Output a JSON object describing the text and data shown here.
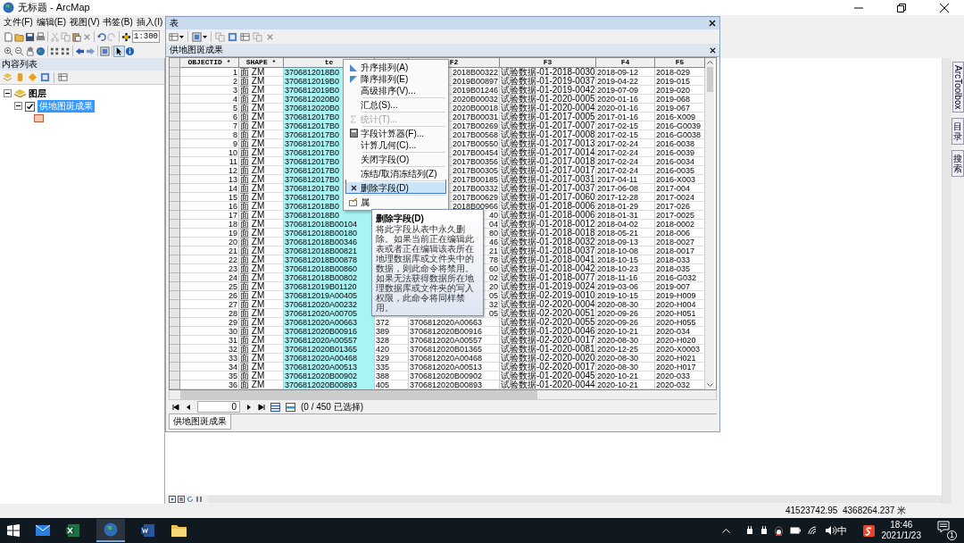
{
  "window": {
    "title": "无标题 - ArcMap"
  },
  "menu_bar": [
    "文件(F)",
    "编辑(E)",
    "视图(V)",
    "书签(B)",
    "插入(I)"
  ],
  "scale_field": {
    "value": "1:300"
  },
  "toc": {
    "title": "内容列表",
    "tree": [
      {
        "label": "图层",
        "expanded": true,
        "children": [
          {
            "label": "供地图斑成果",
            "expanded": true,
            "checked": true,
            "selected": true
          }
        ]
      }
    ]
  },
  "table_window": {
    "title": "表",
    "tab_title": "供地图斑成果",
    "columns": [
      {
        "label": "OBJECTID *",
        "selected": false
      },
      {
        "label": "SHAPE *",
        "selected": false
      },
      {
        "label": "te",
        "selected": true
      },
      {
        "selected": false
      },
      {
        "label": "F2",
        "selected": false
      },
      {
        "label": "F3",
        "selected": false
      },
      {
        "label": "F4",
        "selected": false
      },
      {
        "label": "F5",
        "selected": false
      }
    ],
    "rows": [
      {
        "objectid": "1",
        "shape": "面 ZM",
        "text": "3706812018B0",
        "f2": "2018B00322",
        "f3": "试验数据-01-2018-0030",
        "f4": "2018-09-12",
        "f5": "2018-029"
      },
      {
        "objectid": "2",
        "shape": "面 ZM",
        "text": "3706812019B0",
        "f2": "2019B00897",
        "f3": "试验数据-01-2019-0037",
        "f4": "2019-04-22",
        "f5": "2019-015"
      },
      {
        "objectid": "3",
        "shape": "面 ZM",
        "text": "3706812019B0",
        "f2": "2019B01246",
        "f3": "试验数据-01-2019-0042",
        "f4": "2019-07-09",
        "f5": "2019-020"
      },
      {
        "objectid": "4",
        "shape": "面 ZM",
        "text": "3706812020B0",
        "f2": "2020B00032",
        "f3": "试验数据-01-2020-0005",
        "f4": "2020-01-16",
        "f5": "2019-068"
      },
      {
        "objectid": "5",
        "shape": "面 ZM",
        "text": "3706812020B0",
        "f2": "2020B00018",
        "f3": "试验数据-01-2020-0004",
        "f4": "2020-01-16",
        "f5": "2019-067"
      },
      {
        "objectid": "6",
        "shape": "面 ZM",
        "text": "3706812017B0",
        "f2": "2017B00031",
        "f3": "试验数据-01-2017-0005",
        "f4": "2017-01-16",
        "f5": "2016-X009"
      },
      {
        "objectid": "7",
        "shape": "面 ZM",
        "text": "3706812017B0",
        "f2": "2017B00269",
        "f3": "试验数据-01-2017-0007",
        "f4": "2017-02-15",
        "f5": "2016-G0039"
      },
      {
        "objectid": "8",
        "shape": "面 ZM",
        "text": "3706812017B0",
        "f2": "2017B00568",
        "f3": "试验数据-01-2017-0008",
        "f4": "2017-02-15",
        "f5": "2016-G0038"
      },
      {
        "objectid": "9",
        "shape": "面 ZM",
        "text": "3706812017B0",
        "f2": "2017B00550",
        "f3": "试验数据-01-2017-0013",
        "f4": "2017-02-24",
        "f5": "2016-0038"
      },
      {
        "objectid": "10",
        "shape": "面 ZM",
        "text": "3706812017B0",
        "f2": "2017B00454",
        "f3": "试验数据-01-2017-0014",
        "f4": "2017-02-24",
        "f5": "2016-0039"
      },
      {
        "objectid": "11",
        "shape": "面 ZM",
        "text": "3706812017B0",
        "f2": "2017B00356",
        "f3": "试验数据-01-2017-0018",
        "f4": "2017-02-24",
        "f5": "2016-0034"
      },
      {
        "objectid": "12",
        "shape": "面 ZM",
        "text": "3706812017B0",
        "f2": "2017B00305",
        "f3": "试验数据-01-2017-0017",
        "f4": "2017-02-24",
        "f5": "2016-0035"
      },
      {
        "objectid": "13",
        "shape": "面 ZM",
        "text": "3706812017B0",
        "f2": "2017B00185",
        "f3": "试验数据-01-2017-0031",
        "f4": "2017-04-11",
        "f5": "2016-X003"
      },
      {
        "objectid": "14",
        "shape": "面 ZM",
        "text": "3706812017B0",
        "f2": "2017B00332",
        "f3": "试验数据-01-2017-0037",
        "f4": "2017-06-08",
        "f5": "2017-004"
      },
      {
        "objectid": "15",
        "shape": "面 ZM",
        "text": "3706812017B0",
        "f2": "2017B00629",
        "f3": "试验数据-01-2017-0060",
        "f4": "2017-12-28",
        "f5": "2017-0024"
      },
      {
        "objectid": "16",
        "shape": "面 ZM",
        "text": "3706812018B0",
        "f2": "2018B00966",
        "f3": "试验数据-01-2018-0006",
        "f4": "2018-01-29",
        "f5": "2017-026"
      },
      {
        "objectid": "17",
        "shape": "面 ZM",
        "text": "3706812018B0",
        "f2": "40",
        "f3": "试验数据-01-2018-0006",
        "f4": "2018-01-31",
        "f5": "2017-0025"
      },
      {
        "objectid": "18",
        "shape": "面 ZM",
        "text": "3706812018B00104",
        "f2": "04",
        "f3": "试验数据-01-2018-0012",
        "f4": "2018-04-02",
        "f5": "2018-0002"
      },
      {
        "objectid": "19",
        "shape": "面 ZM",
        "text": "3706812018B00180",
        "f2": "80",
        "f3": "试验数据-01-2018-0018",
        "f4": "2018-05-21",
        "f5": "2018-006"
      },
      {
        "objectid": "20",
        "shape": "面 ZM",
        "text": "3706812018B00346",
        "f2": "46",
        "f3": "试验数据-01-2018-0032",
        "f4": "2018-09-13",
        "f5": "2018-0027"
      },
      {
        "objectid": "21",
        "shape": "面 ZM",
        "text": "3706812018B00821",
        "f2": "21",
        "f3": "试验数据-01-2018-0037",
        "f4": "2018-10-08",
        "f5": "2018-0017"
      },
      {
        "objectid": "22",
        "shape": "面 ZM",
        "text": "3706812018B00878",
        "f2": "78",
        "f3": "试验数据-01-2018-0041",
        "f4": "2018-10-15",
        "f5": "2018-033"
      },
      {
        "objectid": "23",
        "shape": "面 ZM",
        "text": "3706812018B00860",
        "f2": "60",
        "f3": "试验数据-01-2018-0042",
        "f4": "2018-10-23",
        "f5": "2018-035"
      },
      {
        "objectid": "24",
        "shape": "面 ZM",
        "text": "3706812018B00802",
        "f2": "02",
        "f3": "试验数据-01-2018-0077",
        "f4": "2018-11-16",
        "f5": "2016-G032"
      },
      {
        "objectid": "25",
        "shape": "面 ZM",
        "text": "3706812019B01120",
        "f2": "20",
        "f3": "试验数据-01-2019-0024",
        "f4": "2019-03-06",
        "f5": "2019-007"
      },
      {
        "objectid": "26",
        "shape": "面 ZM",
        "text": "3706812019A00405",
        "f2": "05",
        "f3": "试验数据-02-2019-0010",
        "f4": "2019-10-15",
        "f5": "2019-H009"
      },
      {
        "objectid": "27",
        "shape": "面 ZM",
        "text": "3706812020A00232",
        "f2": "32",
        "f3": "试验数据-02-2020-0004",
        "f4": "2020-08-30",
        "f5": "2020-H004"
      },
      {
        "objectid": "28",
        "shape": "面 ZM",
        "text": "3706812020A00705",
        "f2": "05",
        "f3": "试验数据-02-2020-0051",
        "f4": "2020-09-26",
        "f5": "2020-H051"
      },
      {
        "objectid": "29",
        "shape": "面 ZM",
        "text": "3706812020A00663",
        "column_4": "372",
        "f2": "3706812020A00663",
        "f3": "试验数据-02-2020-0055",
        "f4": "2020-09-26",
        "f5": "2020-H055"
      },
      {
        "objectid": "30",
        "shape": "面 ZM",
        "text": "3706812020B00916",
        "column_4": "389",
        "f2": "3706812020B00916",
        "f3": "试验数据-01-2020-0046",
        "f4": "2020-10-21",
        "f5": "2020-034"
      },
      {
        "objectid": "31",
        "shape": "面 ZM",
        "text": "3706812020A00557",
        "column_4": "328",
        "f2": "3706812020A00557",
        "f3": "试验数据-02-2020-0017",
        "f4": "2020-08-30",
        "f5": "2020-H020"
      },
      {
        "objectid": "32",
        "shape": "面 ZM",
        "text": "3706812020B01365",
        "column_4": "420",
        "f2": "3706812020B01365",
        "f3": "试验数据-01-2020-0081",
        "f4": "2020-12-25",
        "f5": "2020-X0003"
      },
      {
        "objectid": "33",
        "shape": "面 ZM",
        "text": "3706812020A00468",
        "column_4": "329",
        "f2": "3706812020A00468",
        "f3": "试验数据-02-2020-0020",
        "f4": "2020-08-30",
        "f5": "2020-H021"
      },
      {
        "objectid": "34",
        "shape": "面 ZM",
        "text": "3706812020A00513",
        "column_4": "335",
        "f2": "3706812020A00513",
        "f3": "试验数据-02-2020-0017",
        "f4": "2020-08-30",
        "f5": "2020-H017"
      },
      {
        "objectid": "35",
        "shape": "面 ZM",
        "text": "3706812020B00902",
        "column_4": "388",
        "f2": "3706812020B00902",
        "f3": "试验数据-01-2020-0045",
        "f4": "2020-10-21",
        "f5": "2020-033"
      },
      {
        "objectid": "36",
        "shape": "面 ZM",
        "text": "3706812020B00893",
        "column_4": "405",
        "f2": "3706812020B00893",
        "f3": "试验数据-01-2020-0044",
        "f4": "2020-10-21",
        "f5": "2020-032"
      }
    ],
    "record_field": {
      "value": "0"
    },
    "selection_count": "(0 / 450 已选择)",
    "bottom_tab": "供地图斑成果"
  },
  "context_menu": [
    {
      "label": "升序排列(A)",
      "disabled": false,
      "selected": false,
      "separator_before": false
    },
    {
      "label": "降序排列(E)",
      "disabled": false,
      "selected": false,
      "separator_before": false
    },
    {
      "label": "高级排序(V)...",
      "disabled": false,
      "selected": false,
      "separator_before": false
    },
    {
      "label": "汇总(S)...",
      "disabled": false,
      "selected": false,
      "separator_before": true
    },
    {
      "label": "统计(T)...",
      "disabled": true,
      "selected": false,
      "separator_before": true
    },
    {
      "label": "字段计算器(F)...",
      "disabled": false,
      "selected": false,
      "separator_before": true
    },
    {
      "label": "计算几何(C)...",
      "disabled": false,
      "selected": false,
      "separator_before": false
    },
    {
      "label": "关闭字段(O)",
      "disabled": false,
      "selected": false,
      "separator_before": true
    },
    {
      "label": "冻结/取消冻结列(Z)",
      "disabled": false,
      "selected": false,
      "separator_before": true
    },
    {
      "label": "删除字段(D)",
      "disabled": false,
      "selected": true,
      "separator_before": true
    },
    {
      "label": "属",
      "disabled": false,
      "selected": false,
      "separator_before": true
    }
  ],
  "tooltip": {
    "title": "删除字段(D)",
    "text": "将此字段从表中永久删除。如果当前正在编辑此表或者正在编辑该表所在地理数据库或文件夹中的数据，则此命令将禁用。如果无法获得数据所在地理数据库或文件夹的写入权限，此命令将同样禁用。"
  },
  "dock_tabs": [
    "ArcToolbox",
    "目录",
    "搜索"
  ],
  "status_bar": {
    "coordinates": "41523742.95  4368264.237 米"
  },
  "taskbar": {
    "ime": "中",
    "clock_time": "18:46",
    "clock_date": "2021/1/23",
    "notification_count": "1"
  }
}
